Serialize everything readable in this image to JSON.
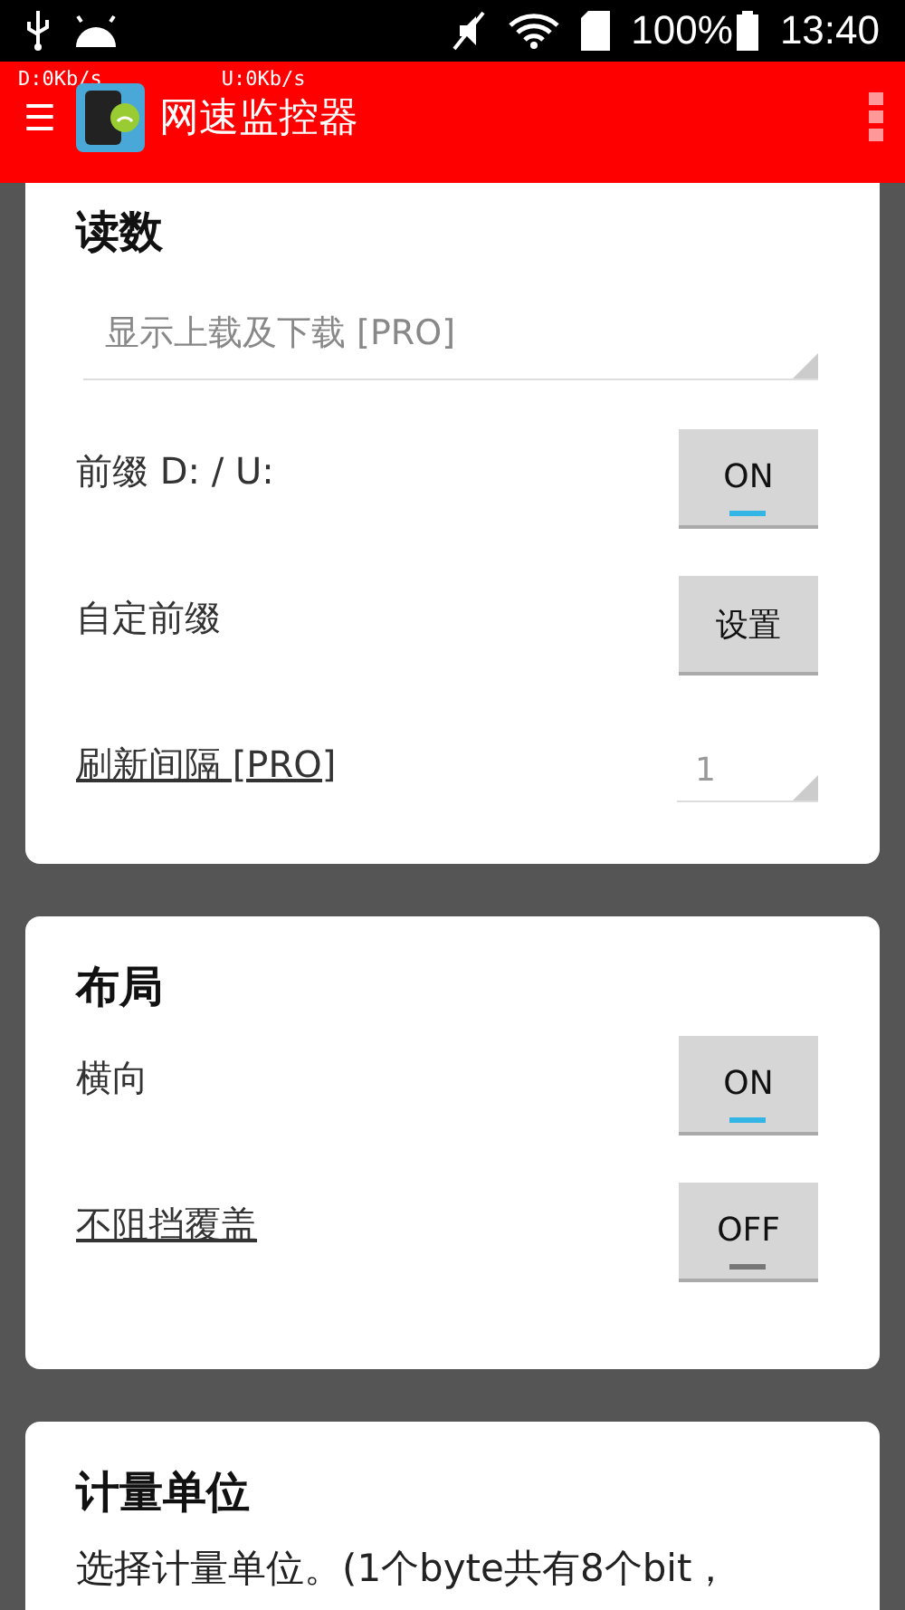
{
  "status_bar": {
    "battery": "100%",
    "time": "13:40"
  },
  "app_bar": {
    "download_speed": "D:0Kb/s",
    "upload_speed": "U:0Kb/s",
    "menu_icon": "☰",
    "title": "网速监控器"
  },
  "cards": [
    {
      "title": "读数",
      "rows": [
        {
          "kind": "dropdown",
          "value": "显示上载及下载 [PRO]"
        },
        {
          "kind": "toggle",
          "label": "前缀 D: / U:",
          "underlined": false,
          "button": "ON",
          "on": true
        },
        {
          "kind": "button",
          "label": "自定前缀",
          "underlined": false,
          "button": "设置"
        },
        {
          "kind": "spinner",
          "label": "刷新间隔 [PRO]",
          "underlined": true,
          "value": "1"
        }
      ]
    },
    {
      "title": "布局",
      "rows": [
        {
          "kind": "toggle",
          "label": "横向",
          "underlined": false,
          "button": "ON",
          "on": true
        },
        {
          "kind": "toggle",
          "label": "不阻挡覆盖",
          "underlined": true,
          "button": "OFF",
          "on": false
        }
      ]
    },
    {
      "title": "计量单位",
      "rows": [
        {
          "kind": "text",
          "text": "选择计量单位。(1个byte共有8个bit，"
        }
      ]
    }
  ]
}
